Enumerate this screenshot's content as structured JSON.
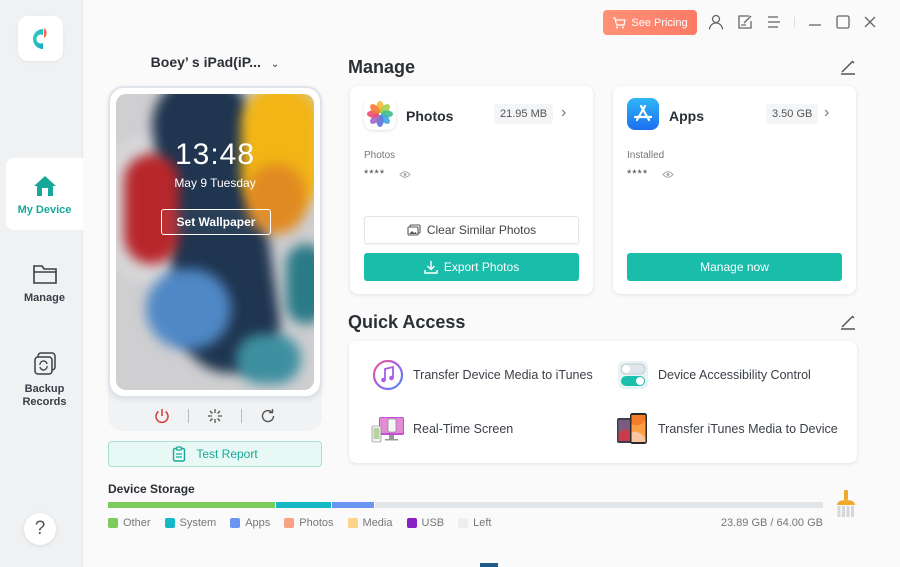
{
  "window": {
    "pricing_button": "See Pricing",
    "top_icons": [
      "user-icon",
      "feedback-edit-icon",
      "menu-icon",
      "minimize-icon",
      "maximize-icon",
      "close-icon"
    ]
  },
  "sidebar": {
    "logo": "app-logo",
    "items": [
      {
        "label": "My Device",
        "icon": "home-icon",
        "active": true
      },
      {
        "label": "Manage",
        "icon": "folder-icon",
        "active": false
      },
      {
        "label": "Backup Records",
        "icon": "backup-icon",
        "active": false
      }
    ],
    "help_label": "?"
  },
  "device": {
    "name": "Boey’ s iPad(iP...",
    "time": "13:48",
    "date": "May 9 Tuesday",
    "set_wallpaper": "Set Wallpaper",
    "controls": [
      "power-icon",
      "loading-icon",
      "refresh-icon"
    ],
    "test_report": "Test Report"
  },
  "manage": {
    "title": "Manage",
    "photos": {
      "title": "Photos",
      "size": "21.95 MB",
      "sub_label": "Photos",
      "count_masked": "****",
      "clear_button": "Clear Similar Photos",
      "export_button": "Export Photos"
    },
    "apps": {
      "title": "Apps",
      "size": "3.50 GB",
      "sub_label": "Installed",
      "count_masked": "****",
      "manage_button": "Manage now"
    }
  },
  "quick_access": {
    "title": "Quick Access",
    "items": [
      {
        "label": "Transfer Device Media to iTunes",
        "icon": "itunes-icon"
      },
      {
        "label": "Device Accessibility Control",
        "icon": "toggle-icon"
      },
      {
        "label": "Real-Time Screen",
        "icon": "screen-mirror-icon"
      },
      {
        "label": "Transfer iTunes Media to Device",
        "icon": "phones-icon"
      }
    ]
  },
  "storage": {
    "title": "Device Storage",
    "used": "23.89 GB",
    "total": "64.00 GB",
    "total_label": "23.89 GB / 64.00 GB",
    "segments": [
      {
        "name": "Other",
        "color": "#7ccb5e",
        "percent": 23.5
      },
      {
        "name": "System",
        "color": "#16b8c4",
        "percent": 7.8
      },
      {
        "name": "Apps",
        "color": "#6a95f0",
        "percent": 6.0
      },
      {
        "name": "Photos",
        "color": "#f7a382",
        "percent": 0
      },
      {
        "name": "Media",
        "color": "#fbd48a",
        "percent": 0
      },
      {
        "name": "USB",
        "color": "#8a1fc4",
        "percent": 0
      },
      {
        "name": "Left",
        "color": "#eceef0",
        "percent": 62.7
      }
    ]
  },
  "colors": {
    "accent": "#1abcaa",
    "pricing": "#fc7a65",
    "sidebar_bg": "#eff1f3"
  }
}
